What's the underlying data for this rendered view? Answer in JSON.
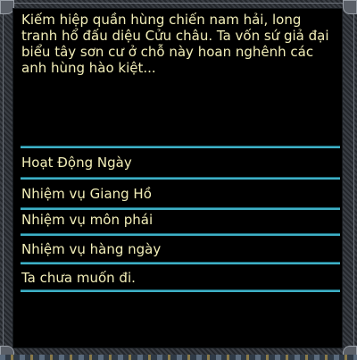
{
  "npc_dialog": {
    "text": "Kiếm hiệp quần hùng chiến nam hải, long tranh hổ đấu diệu Cửu châu. Ta vốn sứ giả đại biểu tây sơn cư ở chỗ này hoan nghênh các anh hùng hào kiệt...",
    "options": [
      {
        "label": "Hoạt Động Ngày"
      },
      {
        "label": "Nhiệm vụ Giang Hồ"
      },
      {
        "label": "Nhiệm vụ môn phái"
      },
      {
        "label": "Nhiệm vụ hàng ngày"
      },
      {
        "label": "Ta chưa muốn đi."
      }
    ]
  },
  "colors": {
    "text": "#f2eeb8",
    "divider": "#3fb0c6",
    "panel_bg": "#000000"
  }
}
